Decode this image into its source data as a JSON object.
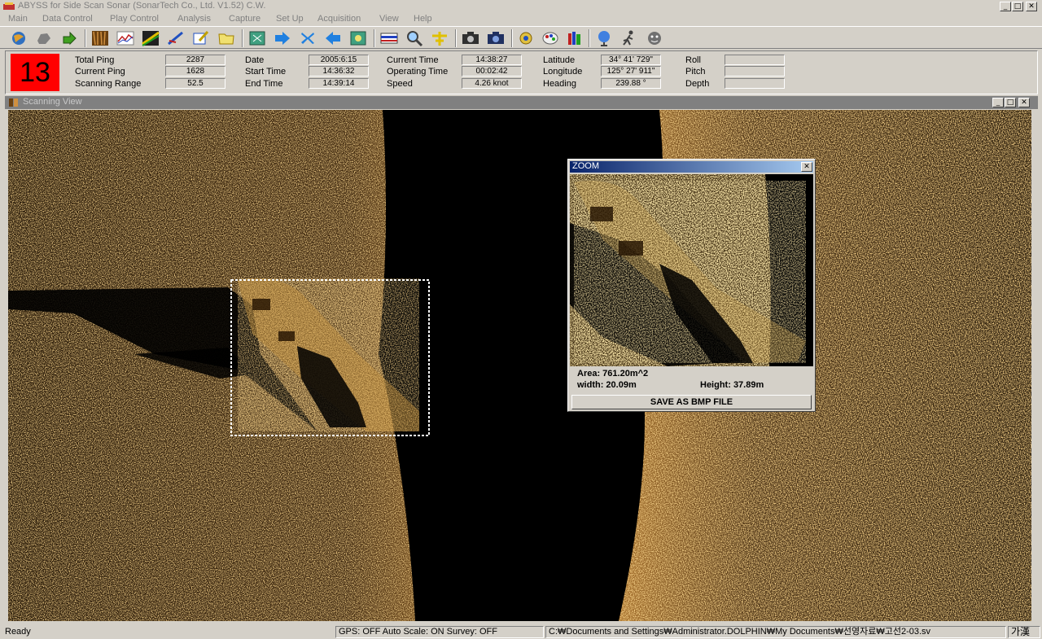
{
  "window": {
    "title": "ABYSS for Side Scan Sonar (SonarTech Co., Ltd.  V1.52) C.W."
  },
  "menu": [
    "Main",
    "Data Control",
    "Play Control",
    "Analysis",
    "Capture",
    "Set Up",
    "Acquisition",
    "View",
    "Help"
  ],
  "info": {
    "ping_badge": "13",
    "total_ping_label": "Total Ping",
    "total_ping": "2287",
    "current_ping_label": "Current Ping",
    "current_ping": "1628",
    "scanning_range_label": "Scanning Range",
    "scanning_range": "52.5",
    "date_label": "Date",
    "date": "2005:6:15",
    "start_time_label": "Start Time",
    "start_time": "14:36:32",
    "end_time_label": "End Time",
    "end_time": "14:39:14",
    "current_time_label": "Current Time",
    "current_time": "14:38:27",
    "operating_time_label": "Operating Time",
    "operating_time": "00:02:42",
    "speed_label": "Speed",
    "speed": "4.26 knot",
    "latitude_label": "Latitude",
    "latitude": "34° 41' 729\"",
    "longitude_label": "Longitude",
    "longitude": "125° 27' 911\"",
    "heading_label": "Heading",
    "heading": "239.88 °",
    "roll_label": "Roll",
    "roll": "",
    "pitch_label": "Pitch",
    "pitch": "",
    "depth_label": "Depth",
    "depth": ""
  },
  "scan_view": {
    "title": "Scanning View"
  },
  "zoom": {
    "title": "ZOOM",
    "area": "Area:  761.20m^2",
    "width": "width: 20.09m",
    "height": "Height: 37.89m",
    "save_button": "SAVE AS BMP FILE"
  },
  "status": {
    "ready": "Ready",
    "gps": "GPS: OFF  Auto Scale: ON  Survey: OFF",
    "path": "C:₩Documents and Settings₩Administrator.DOLPHIN₩My Documents₩선영자료₩고선2-03.sv",
    "ime": "가漢"
  },
  "colors": {
    "sonar_gold": "#e0a040",
    "ping_badge_bg": "#ff0000",
    "zoom_title_bg": "#0a246a"
  }
}
